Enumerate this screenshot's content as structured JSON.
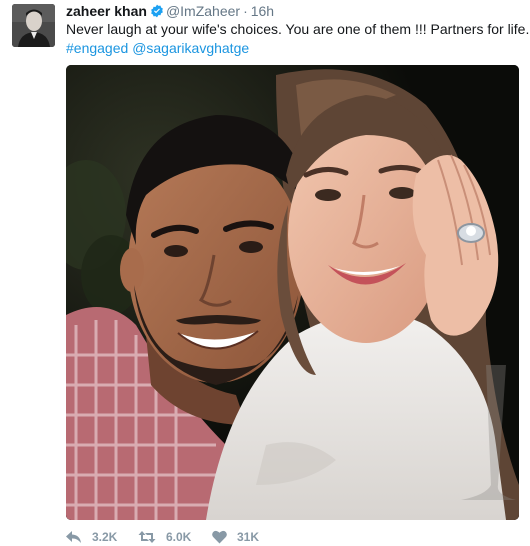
{
  "tweet": {
    "display_name": "zaheer khan",
    "handle": "@ImZaheer",
    "separator": "·",
    "time": "16h",
    "text": "Never laugh at your wife's choices. You are one of them !!!  Partners for life.",
    "hashtag": "#engaged",
    "mention": "@sagarikavghatge",
    "verified": true
  },
  "actions": {
    "reply_count": "3.2K",
    "retweet_count": "6.0K",
    "like_count": "31K"
  },
  "colors": {
    "link": "#1b95e0",
    "verified_badge": "#1da1f2",
    "muted": "#657786",
    "action_icon": "#8899a6"
  }
}
